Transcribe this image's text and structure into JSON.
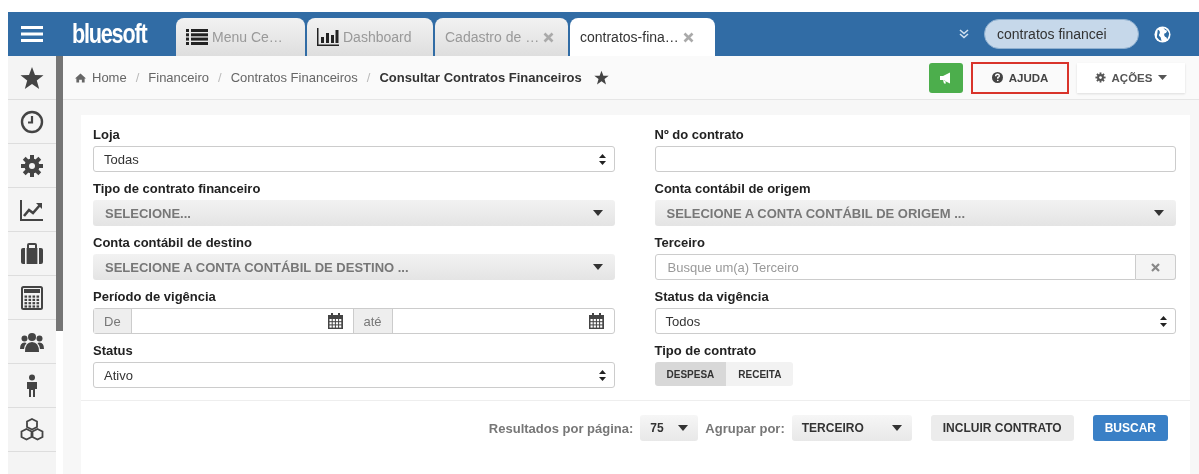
{
  "topbar": {
    "logo": "bluesoft",
    "tabs": [
      {
        "label": "Menu Ce…",
        "closable": false,
        "selected": false
      },
      {
        "label": "Dashboard",
        "closable": false,
        "selected": false
      },
      {
        "label": "Cadastro de …",
        "closable": true,
        "selected": false
      },
      {
        "label": "contratos-fina…",
        "closable": true,
        "selected": true
      }
    ],
    "search": {
      "value": "contratos financei"
    }
  },
  "breadcrumb": {
    "items": [
      "Home",
      "Financeiro",
      "Contratos Financeiros"
    ],
    "separator": "/",
    "current": "Consultar Contratos Financeiros"
  },
  "actions": {
    "help": {
      "label": "AJUDA",
      "highlighted": true
    },
    "menu": {
      "label": "AÇÕES"
    }
  },
  "form": {
    "left": [
      {
        "kind": "select",
        "label": "Loja",
        "value": "Todas"
      },
      {
        "kind": "combo",
        "label": "Tipo de contrato financeiro",
        "placeholder": "SELECIONE..."
      },
      {
        "kind": "combo",
        "label": "Conta contábil de destino",
        "placeholder": "SELECIONE A CONTA CONTÁBIL DE DESTINO ..."
      },
      {
        "kind": "daterange",
        "label": "Período de vigência",
        "from": "De",
        "to": "até"
      },
      {
        "kind": "select",
        "label": "Status",
        "value": "Ativo"
      }
    ],
    "right": [
      {
        "kind": "text",
        "label": "Nº do contrato"
      },
      {
        "kind": "combo",
        "label": "Conta contábil de origem",
        "placeholder": "SELECIONE A CONTA CONTÁBIL DE ORIGEM ..."
      },
      {
        "kind": "search",
        "label": "Terceiro",
        "placeholder": "Busque um(a) Terceiro"
      },
      {
        "kind": "select",
        "label": "Status da vigência",
        "value": "Todos"
      },
      {
        "kind": "toggle",
        "label": "Tipo de contrato",
        "options": [
          {
            "label": "DESPESA",
            "selected": true
          },
          {
            "label": "RECEITA",
            "selected": false
          }
        ]
      }
    ]
  },
  "footer": {
    "per_page_label": "Resultados por página:",
    "per_page": "75",
    "group_label": "Agrupar por:",
    "group": "TERCEIRO",
    "include_button": "INCLUIR CONTRATO",
    "search_button": "BUSCAR"
  }
}
